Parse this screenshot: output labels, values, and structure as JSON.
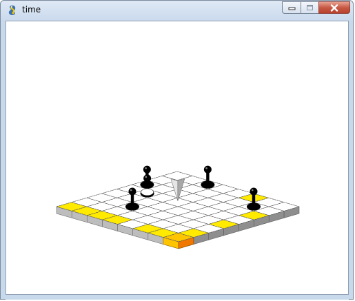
{
  "window": {
    "title": "time",
    "icons": {
      "app": "python-snake-icon",
      "minimize": "minimize-icon",
      "maximize": "maximize-icon",
      "close": "close-icon"
    }
  },
  "game": {
    "board": {
      "columns": 8,
      "rows": 8
    },
    "colors": {
      "tile": "#ffffff",
      "highlight": "#ffea00",
      "selected_top": "#ffc400",
      "selected_side": "#f07800",
      "side_left": "#bdbdbd",
      "side_right": "#8e8e8e",
      "piece": "#000000",
      "cursor": "#cfcfcf"
    },
    "highlighted_cells": [
      {
        "col": 7,
        "row": 0
      },
      {
        "col": 7,
        "row": 1
      },
      {
        "col": 7,
        "row": 2
      },
      {
        "col": 7,
        "row": 3
      },
      {
        "col": 7,
        "row": 5
      },
      {
        "col": 7,
        "row": 6
      },
      {
        "col": 6,
        "row": 7
      },
      {
        "col": 4,
        "row": 7
      },
      {
        "col": 2,
        "row": 7
      },
      {
        "col": 0,
        "row": 5
      }
    ],
    "selected_cell": {
      "col": 7,
      "row": 7
    },
    "pieces": [
      {
        "name": "black-pawn",
        "col": 5,
        "row": 2
      },
      {
        "name": "black-pawn",
        "col": 3,
        "row": 1
      },
      {
        "name": "black-pawn",
        "col": 2,
        "row": 0
      },
      {
        "name": "black-pawn",
        "col": 0,
        "row": 2
      },
      {
        "name": "black-pawn",
        "col": 1,
        "row": 6
      }
    ],
    "cursor": {
      "name": "cone-cursor",
      "col": 3,
      "row": 3
    },
    "cursor_marker_cell": {
      "col": 3,
      "row": 1
    }
  }
}
